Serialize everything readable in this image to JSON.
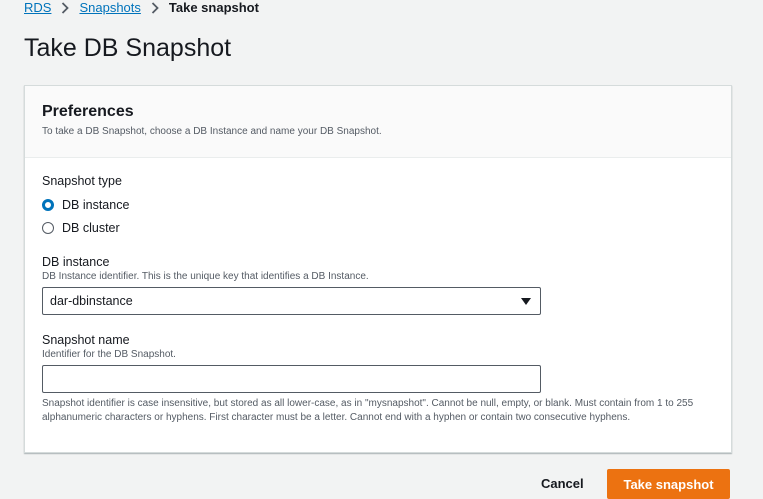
{
  "breadcrumb": {
    "items": [
      "RDS",
      "Snapshots"
    ],
    "current": "Take snapshot"
  },
  "page": {
    "title": "Take DB Snapshot"
  },
  "preferences": {
    "title": "Preferences",
    "description": "To take a DB Snapshot, choose a DB Instance and name your DB Snapshot."
  },
  "snapshot_type": {
    "label": "Snapshot type",
    "options": [
      "DB instance",
      "DB cluster"
    ],
    "selected": "DB instance"
  },
  "db_instance": {
    "label": "DB instance",
    "description": "DB Instance identifier. This is the unique key that identifies a DB Instance.",
    "value": "dar-dbinstance"
  },
  "snapshot_name": {
    "label": "Snapshot name",
    "description": "Identifier for the DB Snapshot.",
    "value": "",
    "constraint": "Snapshot identifier is case insensitive, but stored as all lower-case, as in \"mysnapshot\". Cannot be null, empty, or blank. Must contain from 1 to 255 alphanumeric characters or hyphens. First character must be a letter. Cannot end with a hyphen or contain two consecutive hyphens."
  },
  "actions": {
    "cancel": "Cancel",
    "submit": "Take snapshot"
  },
  "colors": {
    "link": "#0073bb",
    "primary": "#ec7211",
    "background": "#f2f3f3"
  }
}
